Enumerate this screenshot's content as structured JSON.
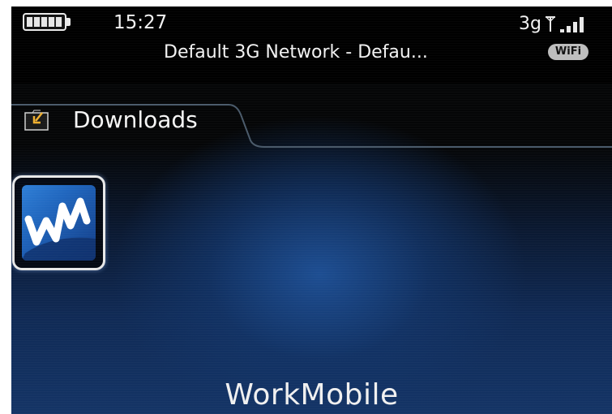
{
  "status_bar": {
    "time": "15:27",
    "network_name": "Default 3G Network - Defau...",
    "network_type": "3g",
    "wifi_badge": "WiFi",
    "battery_icon": "battery-full-icon",
    "signal_icon": "signal-strength-icon"
  },
  "folder": {
    "label": "Downloads",
    "icon": "folder-download-icon"
  },
  "apps": [
    {
      "name": "WorkMobile",
      "icon": "workmobile-app-icon",
      "selected": true
    }
  ],
  "colors": {
    "background_top": "#050607",
    "background_glow": "#1e5096",
    "selection_border": "#e8e8e8",
    "app_icon_blue": "#2066be"
  }
}
